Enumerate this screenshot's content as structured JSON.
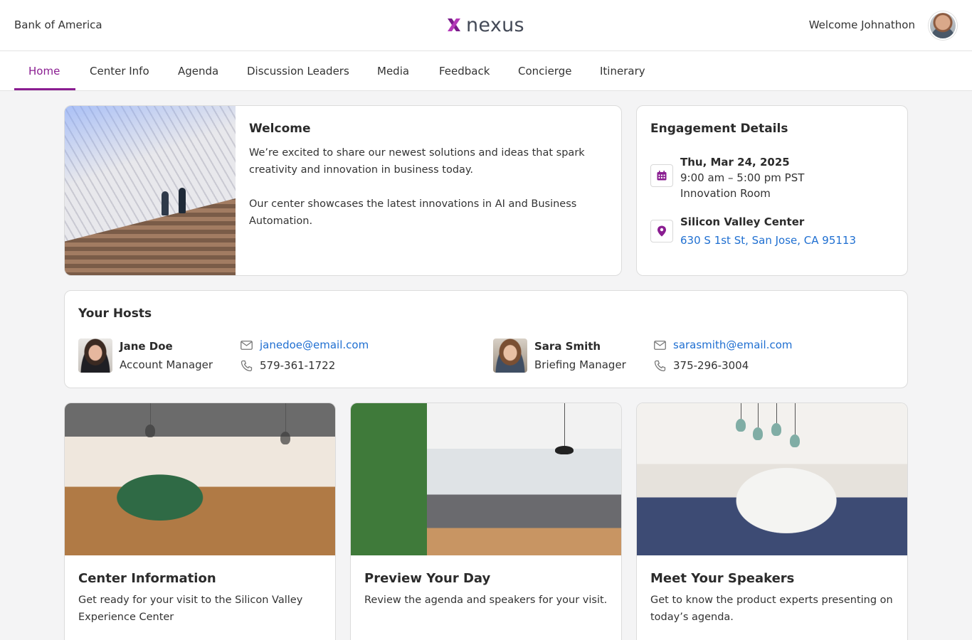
{
  "header": {
    "company": "Bank of America",
    "logo_text": "nexus",
    "welcome": "Welcome Johnathon"
  },
  "nav": {
    "items": [
      {
        "label": "Home",
        "active": true
      },
      {
        "label": "Center Info"
      },
      {
        "label": "Agenda"
      },
      {
        "label": "Discussion Leaders"
      },
      {
        "label": "Media"
      },
      {
        "label": "Feedback"
      },
      {
        "label": "Concierge"
      },
      {
        "label": "Itinerary"
      }
    ]
  },
  "welcome": {
    "title": "Welcome",
    "paragraph1": "We’re excited to share our newest solutions and ideas that spark creativity and innovation in business today.",
    "paragraph2": "Our center showcases the latest innovations in AI and Business Automation."
  },
  "engagement": {
    "title": "Engagement Details",
    "date": "Thu, Mar 24, 2025",
    "time": "9:00 am – 5:00 pm PST",
    "room": "Innovation Room",
    "location_name": "Silicon Valley Center",
    "address": "630 S 1st St, San Jose, CA 95113"
  },
  "hosts": {
    "title": "Your Hosts",
    "people": [
      {
        "name": "Jane Doe",
        "role": "Account Manager",
        "email": "janedoe@email.com",
        "phone": "579-361-1722"
      },
      {
        "name": "Sara Smith",
        "role": "Briefing Manager",
        "email": "sarasmith@email.com",
        "phone": "375-296-3004"
      }
    ]
  },
  "tiles": [
    {
      "title": "Center Information",
      "text": "Get ready for your visit to the Silicon Valley Experience Center"
    },
    {
      "title": "Preview Your Day",
      "text": "Review the agenda and speakers for your visit."
    },
    {
      "title": "Meet Your Speakers",
      "text": "Get to know the product experts presenting on today’s agenda."
    }
  ],
  "colors": {
    "accent": "#8a1d91",
    "link": "#1f6fd1",
    "background": "#f4f4f5"
  }
}
